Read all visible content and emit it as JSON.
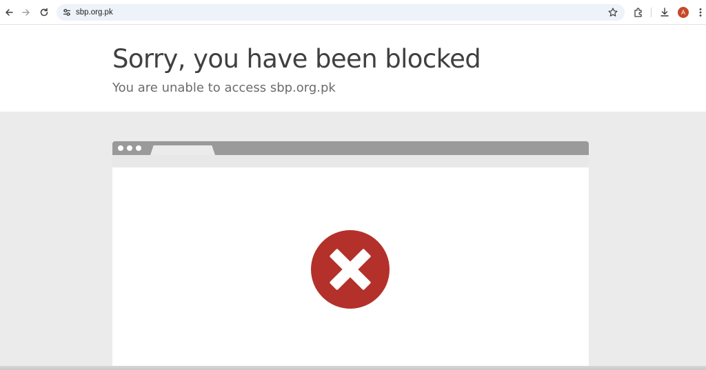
{
  "browser": {
    "url": "sbp.org.pk",
    "avatar_initial": "A",
    "icons": {
      "back": "back-arrow-icon",
      "forward": "forward-arrow-icon",
      "reload": "reload-icon",
      "site_info": "tune-icon",
      "bookmark": "star-icon",
      "extensions": "puzzle-icon",
      "downloads": "download-icon",
      "menu": "kebab-menu-icon"
    }
  },
  "page": {
    "title": "Sorry, you have been blocked",
    "subtitle": "You are unable to access sbp.org.pk",
    "colors": {
      "error_red": "#b3312a",
      "frame_gray": "#9a9a9a",
      "background_gray": "#ebebeb",
      "title_text": "#404040"
    },
    "illustration_icon": "error-x-circle-icon"
  }
}
